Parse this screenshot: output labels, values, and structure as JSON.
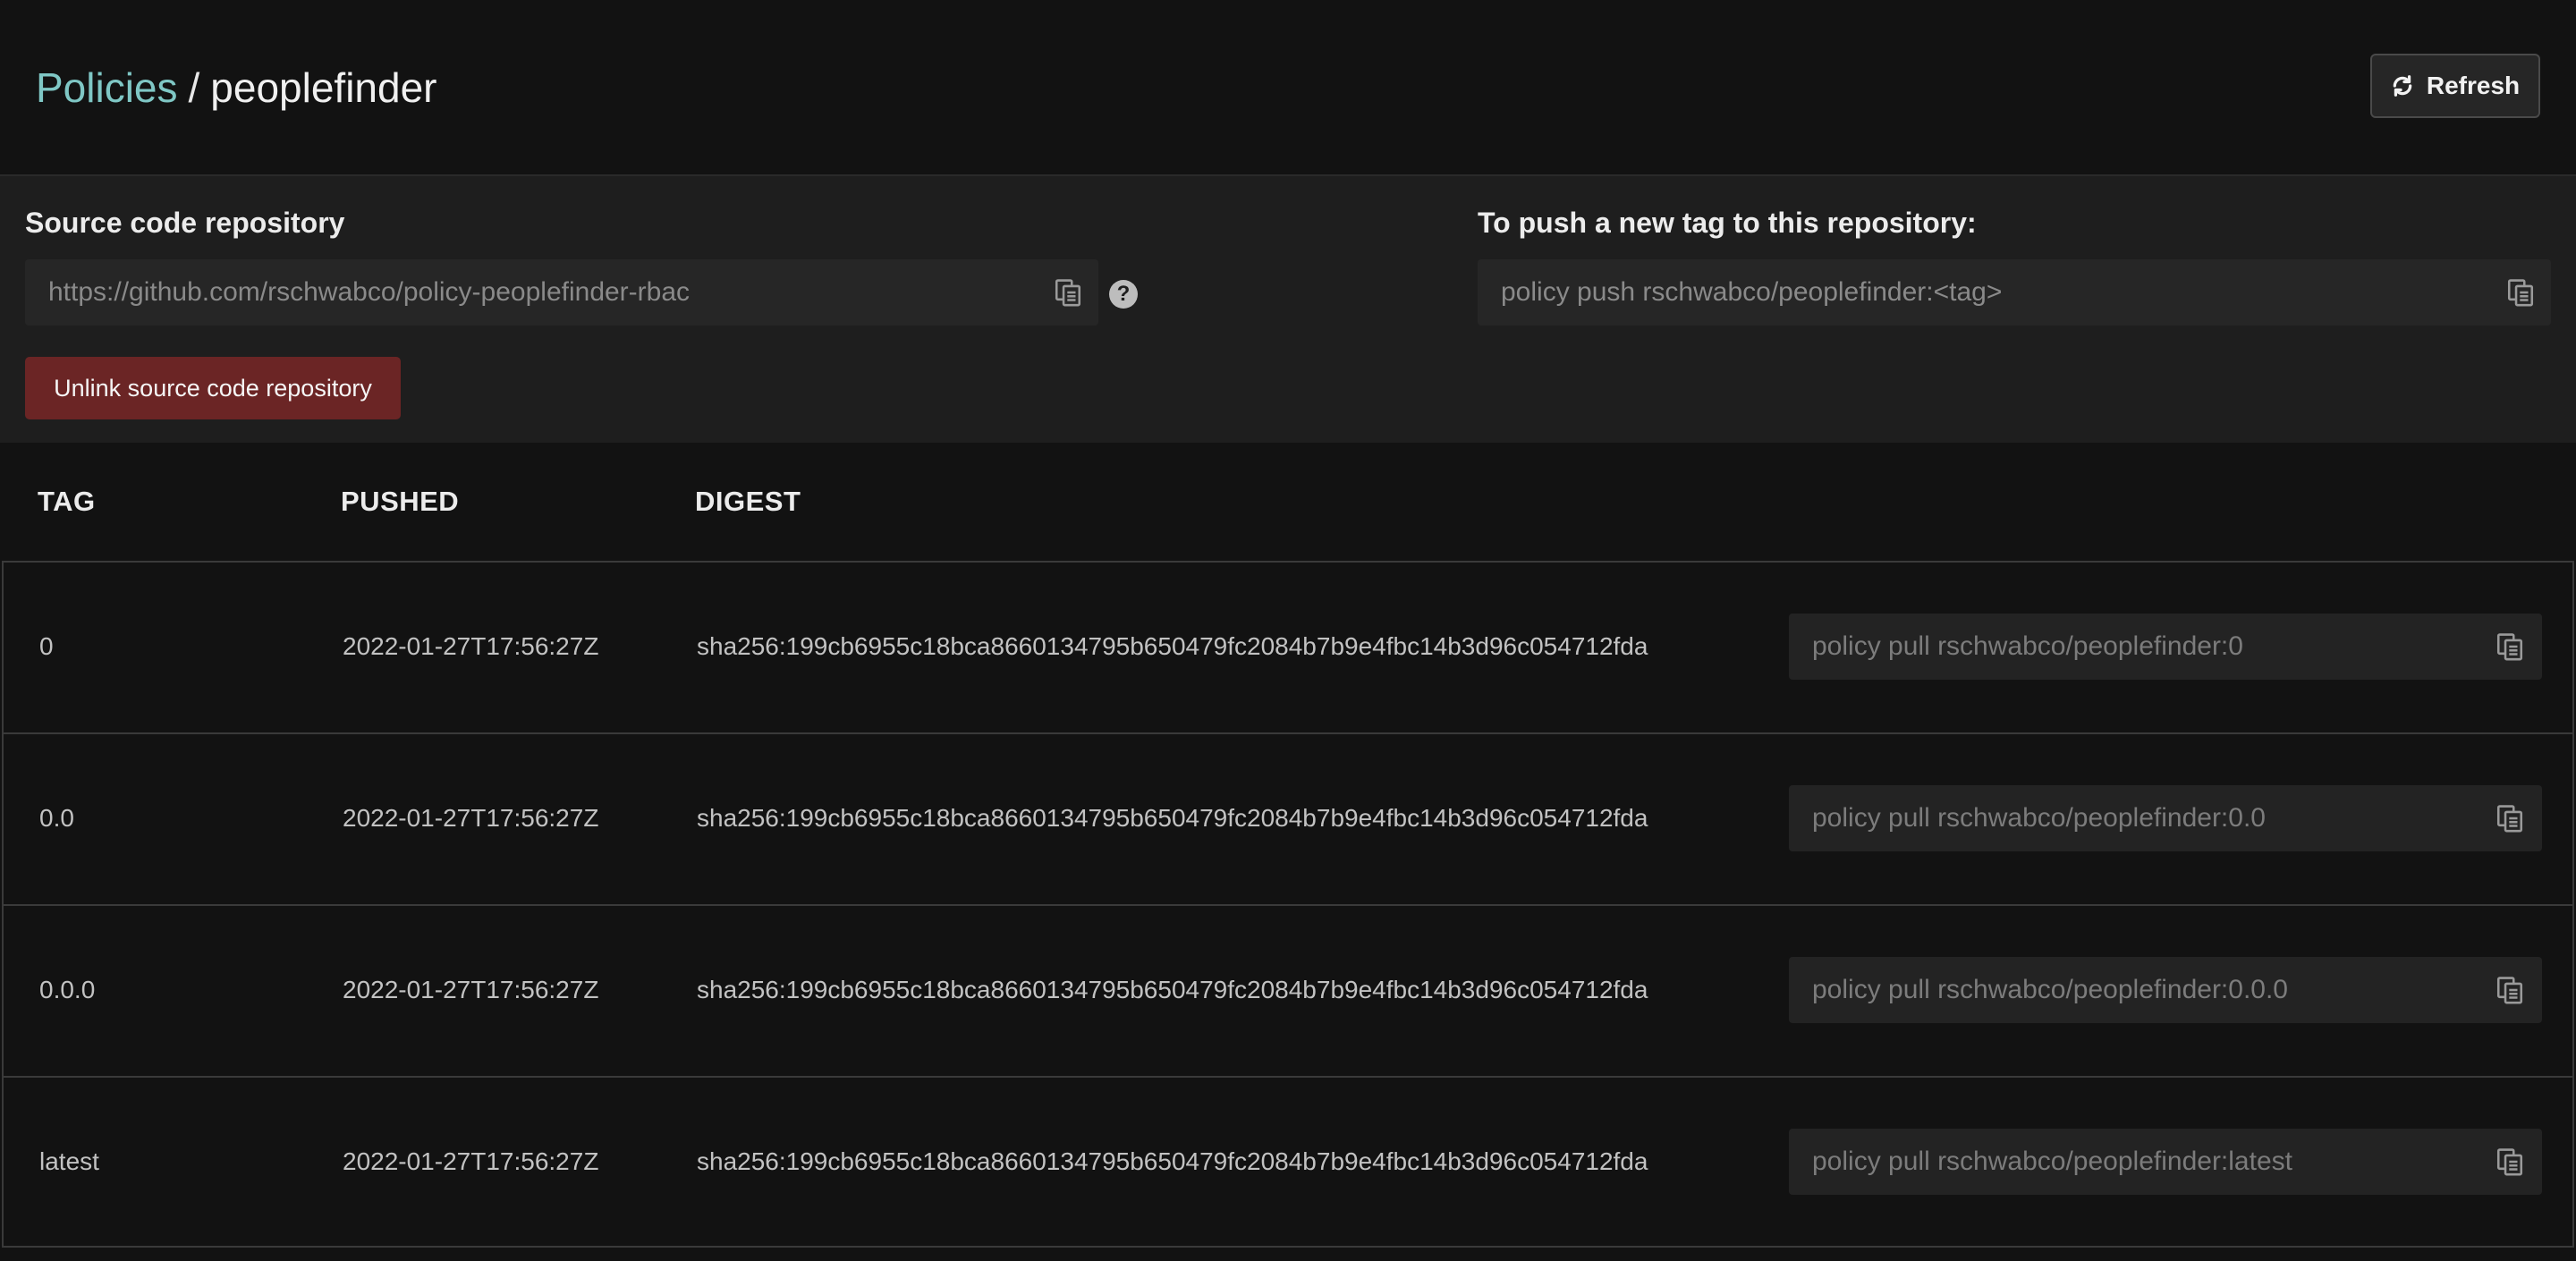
{
  "header": {
    "breadcrumb_root": "Policies",
    "breadcrumb_sep": "/",
    "breadcrumb_current": "peoplefinder",
    "refresh_label": "Refresh"
  },
  "repo": {
    "source_label": "Source code repository",
    "source_url": "https://github.com/rschwabco/policy-peoplefinder-rbac",
    "push_label": "To push a new tag to this repository:",
    "push_command": "policy push rschwabco/peoplefinder:<tag>",
    "unlink_label": "Unlink source code repository"
  },
  "table": {
    "columns": [
      "TAG",
      "PUSHED",
      "DIGEST"
    ],
    "rows": [
      {
        "tag": "0",
        "pushed": "2022-01-27T17:56:27Z",
        "digest": "sha256:199cb6955c18bca8660134795b650479fc2084b7b9e4fbc14b3d96c054712fda",
        "pull": "policy pull rschwabco/peoplefinder:0"
      },
      {
        "tag": "0.0",
        "pushed": "2022-01-27T17:56:27Z",
        "digest": "sha256:199cb6955c18bca8660134795b650479fc2084b7b9e4fbc14b3d96c054712fda",
        "pull": "policy pull rschwabco/peoplefinder:0.0"
      },
      {
        "tag": "0.0.0",
        "pushed": "2022-01-27T17:56:27Z",
        "digest": "sha256:199cb6955c18bca8660134795b650479fc2084b7b9e4fbc14b3d96c054712fda",
        "pull": "policy pull rschwabco/peoplefinder:0.0.0"
      },
      {
        "tag": "latest",
        "pushed": "2022-01-27T17:56:27Z",
        "digest": "sha256:199cb6955c18bca8660134795b650479fc2084b7b9e4fbc14b3d96c054712fda",
        "pull": "policy pull rschwabco/peoplefinder:latest"
      }
    ]
  },
  "icons": {
    "refresh": "refresh-icon",
    "copy": "copy-icon",
    "help": "help-icon"
  },
  "colors": {
    "accent_link": "#7fc7c5",
    "danger_button": "#6b2525",
    "background": "#121212",
    "panel": "#1e1e1e"
  }
}
